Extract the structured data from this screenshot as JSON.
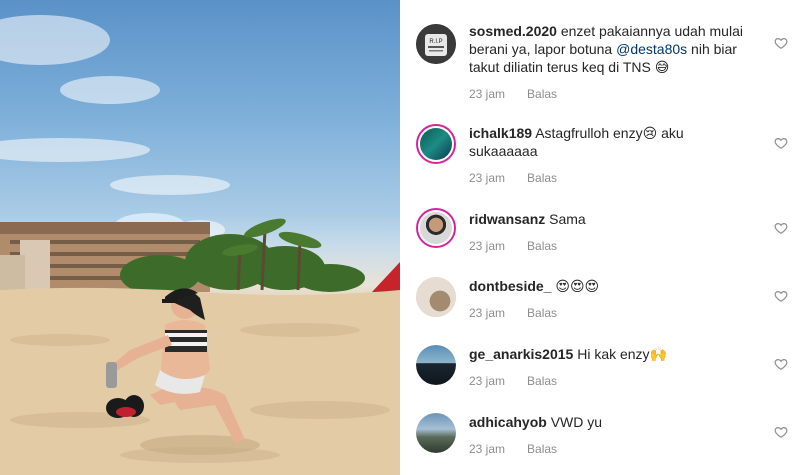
{
  "photo": {
    "alt_icon": "beach-photo"
  },
  "comments": [
    {
      "username": "sosmed.2020",
      "text_before": "enzet pakaiannya udah mulai berani ya, lapor botuna ",
      "mention": "@desta80s",
      "text_after": " nih biar takut diliatin terus keq di TNS 😅",
      "time": "23 jam",
      "reply": "Balas",
      "avatar_text": "R.I.P"
    },
    {
      "username": "ichalk189",
      "text": "Astagfrulloh enzy😢 aku sukaaaaaa",
      "time": "23 jam",
      "reply": "Balas"
    },
    {
      "username": "ridwansanz",
      "text": "Sama",
      "time": "23 jam",
      "reply": "Balas"
    },
    {
      "username": "dontbeside_",
      "text": "😍😍😍",
      "time": "23 jam",
      "reply": "Balas"
    },
    {
      "username": "ge_anarkis2015",
      "text": "Hi kak enzy🙌",
      "time": "23 jam",
      "reply": "Balas"
    },
    {
      "username": "adhicahyob",
      "text": "VWD yu",
      "time": "23 jam",
      "reply": "Balas"
    }
  ],
  "colors": {
    "username": "#262626",
    "meta": "#8e8e8e",
    "mention": "#00376b",
    "story_ring": "#d6249f"
  }
}
